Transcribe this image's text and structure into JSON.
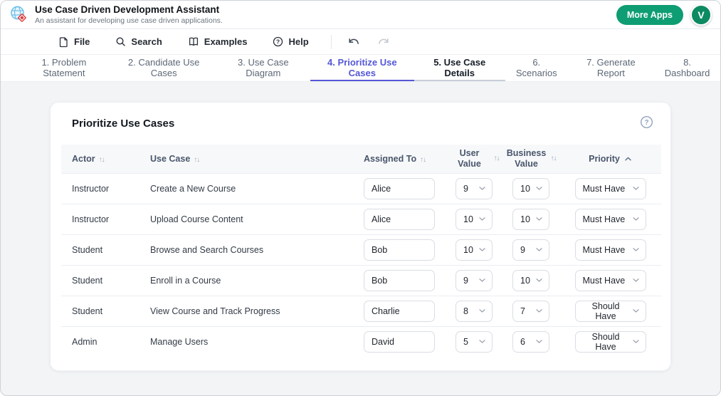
{
  "header": {
    "title": "Use Case Driven Development Assistant",
    "subtitle": "An assistant for developing use case driven applications.",
    "more_apps_label": "More Apps",
    "avatar_letter": "V"
  },
  "toolbar": {
    "items": [
      "File",
      "Search",
      "Examples",
      "Help"
    ]
  },
  "tabs": [
    "1. Problem Statement",
    "2. Candidate Use Cases",
    "3. Use Case Diagram",
    "4. Prioritize Use Cases",
    "5. Use Case Details",
    "6. Scenarios",
    "7. Generate Report",
    "8. Dashboard"
  ],
  "card": {
    "title": "Prioritize Use Cases"
  },
  "icons": {
    "sort": "↑↓"
  },
  "colors": {
    "accent_green": "#0f9d73",
    "avatar_green": "#0c8a62",
    "active_tab": "#5457d6"
  },
  "table": {
    "columns": [
      "Actor",
      "Use Case",
      "Assigned To",
      "User Value",
      "Business Value",
      "Priority"
    ],
    "priority_sort_state": "ascending",
    "rows": [
      {
        "actor": "Instructor",
        "use_case": "Create a New Course",
        "assigned_to": "Alice",
        "user_value": "9",
        "business_value": "10",
        "priority": "Must Have"
      },
      {
        "actor": "Instructor",
        "use_case": "Upload Course Content",
        "assigned_to": "Alice",
        "user_value": "10",
        "business_value": "10",
        "priority": "Must Have"
      },
      {
        "actor": "Student",
        "use_case": "Browse and Search Courses",
        "assigned_to": "Bob",
        "user_value": "10",
        "business_value": "9",
        "priority": "Must Have"
      },
      {
        "actor": "Student",
        "use_case": "Enroll in a Course",
        "assigned_to": "Bob",
        "user_value": "9",
        "business_value": "10",
        "priority": "Must Have"
      },
      {
        "actor": "Student",
        "use_case": "View Course and Track Progress",
        "assigned_to": "Charlie",
        "user_value": "8",
        "business_value": "7",
        "priority": "Should Have"
      },
      {
        "actor": "Admin",
        "use_case": "Manage Users",
        "assigned_to": "David",
        "user_value": "5",
        "business_value": "6",
        "priority": "Should Have"
      }
    ]
  }
}
